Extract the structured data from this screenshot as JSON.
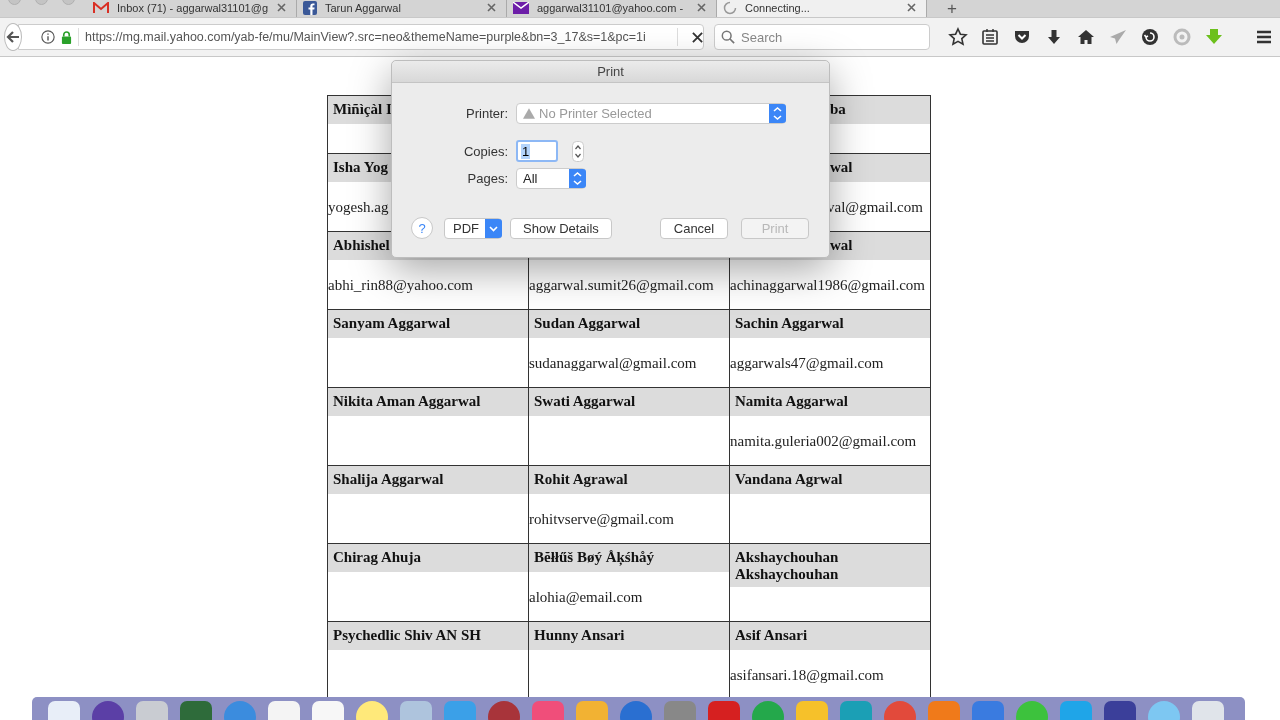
{
  "browser": {
    "tabs": [
      {
        "label": "Inbox (71) - aggarwal31101@g",
        "selected": false,
        "kind": "gmail"
      },
      {
        "label": "Tarun Aggarwal",
        "selected": false,
        "kind": "facebook"
      },
      {
        "label": "aggarwal31101@yahoo.com -",
        "selected": false,
        "kind": "mail"
      },
      {
        "label": "Connecting...",
        "selected": true,
        "kind": "loading"
      }
    ],
    "new_tab": "+",
    "address": "https://mg.mail.yahoo.com/yab-fe/mu/MainView?.src=neo&themeName=purple&bn=3_17&s=1&pc=1i",
    "search": {
      "placeholder": "Search"
    }
  },
  "contacts": {
    "rows": [
      [
        {
          "name": "Mìñìçàl I"
        },
        {},
        {
          "name": "ba",
          "name_covered": true
        }
      ],
      [
        {
          "name": "Isha Yog",
          "email": "yogesh.ag"
        },
        {},
        {
          "name": "wal",
          "email": "val@gmail.com",
          "name_covered": true,
          "email_covered": true
        }
      ],
      [
        {
          "name": "Abhishel",
          "email": "abhi_rin88@yahoo.com"
        },
        {
          "email": "aggarwal.sumit26@gmail.com"
        },
        {
          "name": "wal",
          "email": "achinaggarwal1986@gmail.com",
          "name_covered": true
        }
      ],
      [
        {
          "name": "Sanyam Aggarwal"
        },
        {
          "name": "Sudan Aggarwal",
          "email": "sudanaggarwal@gmail.com"
        },
        {
          "name": "Sachin Aggarwal",
          "email": "aggarwals47@gmail.com"
        }
      ],
      [
        {
          "name": "Nikita Aman Aggarwal"
        },
        {
          "name": "Swati Aggarwal"
        },
        {
          "name": "Namita Aggarwal",
          "email": "namita.guleria002@gmail.com"
        }
      ],
      [
        {
          "name": "Shalija Aggarwal"
        },
        {
          "name": "Rohit Agrawal",
          "email": "rohitvserve@gmail.com"
        },
        {
          "name": "Vandana Agrwal"
        }
      ],
      [
        {
          "name": "Chirag Ahuja"
        },
        {
          "name": "Bĕłłűš Bøý Åķśhåý",
          "email": "alohia@email.com"
        },
        {
          "name": "Akshaychouhan Akshaychouhan"
        }
      ],
      [
        {
          "name": "Psychedlic Shiv AN SH"
        },
        {
          "name": "Hunny Ansari"
        },
        {
          "name": "Asif Ansari",
          "email": "asifansari.18@gmail.com"
        }
      ]
    ]
  },
  "print_dialog": {
    "title": "Print",
    "printer": {
      "label": "Printer:",
      "value": "No Printer Selected"
    },
    "copies": {
      "label": "Copies:",
      "value": "1",
      "text_selected": true
    },
    "pages": {
      "label": "Pages:",
      "value": "All"
    },
    "help": "?",
    "pdf": "PDF",
    "buttons": [
      {
        "label": "Show Details",
        "disabled": false
      },
      {
        "label": "Cancel",
        "disabled": false
      },
      {
        "label": "Print",
        "disabled": true
      }
    ]
  }
}
